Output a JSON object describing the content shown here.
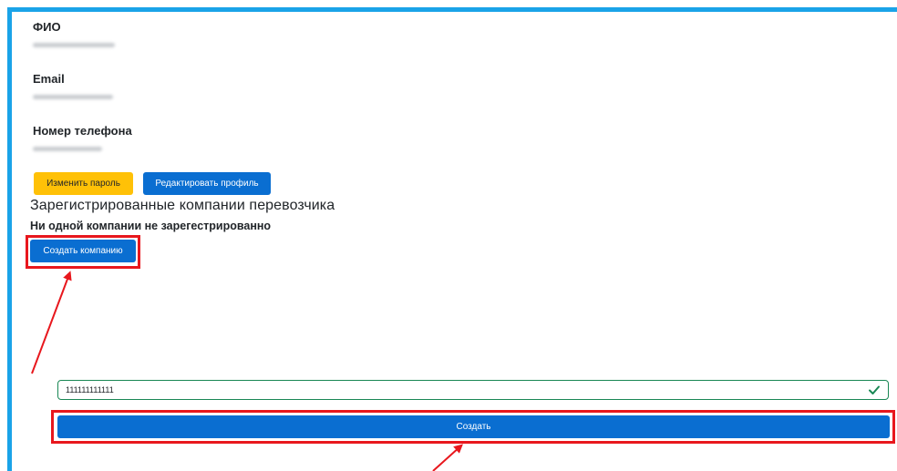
{
  "profile": {
    "fio_label": "ФИО",
    "email_label": "Email",
    "phone_label": "Номер телефона"
  },
  "actions": {
    "change_password": "Изменить пароль",
    "edit_profile": "Редактировать профиль"
  },
  "companies": {
    "title": "Зарегистрированные компании перевозчика",
    "empty_note": "Ни одной компании не зарегестрированно",
    "create_company": "Создать компанию"
  },
  "form": {
    "field_value": "111111111111",
    "submit": "Создать"
  },
  "colors": {
    "frame": "#1aa3e8",
    "primary": "#0a6ed1",
    "warning": "#ffc107",
    "highlight": "#e8171d",
    "valid": "#198754"
  }
}
